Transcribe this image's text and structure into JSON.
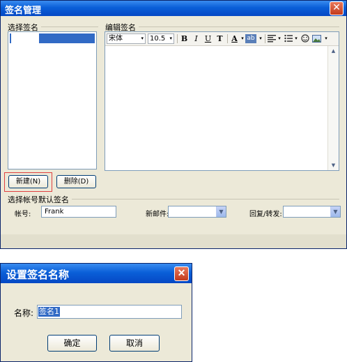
{
  "signature_window": {
    "title": "签名管理",
    "close_glyph": "✕",
    "select_group_label": "选择签名",
    "edit_group_label": "编辑签名",
    "toolbar": {
      "font_name": "宋体",
      "font_size": "10.5",
      "bold": "B",
      "italic": "I",
      "underline": "U",
      "strike": "T",
      "font_color": "A",
      "highlight": "ab",
      "dropdown_glyph": "▾",
      "icons": [
        "font-color-icon",
        "highlight-icon",
        "align-icon",
        "list-icon",
        "emoji-icon",
        "image-icon"
      ]
    },
    "new_button": "新建(N)",
    "delete_button": "删除(D)",
    "account_group_label": "选择帐号默认签名",
    "account_label": "帐号:",
    "account_value": "Frank",
    "new_mail_label": "新邮件:",
    "reply_label": "回复/转发:",
    "scroll_up": "▲",
    "scroll_down": "▼"
  },
  "name_dialog": {
    "title": "设置签名名称",
    "close_glyph": "✕",
    "name_label": "名称:",
    "name_value": "签名1",
    "ok_button": "确定",
    "cancel_button": "取消"
  },
  "colors": {
    "titlebar": "#0a5fd8",
    "selection": "#316ac5",
    "window_bg": "#ece9d8",
    "highlight_border": "#e04040"
  }
}
